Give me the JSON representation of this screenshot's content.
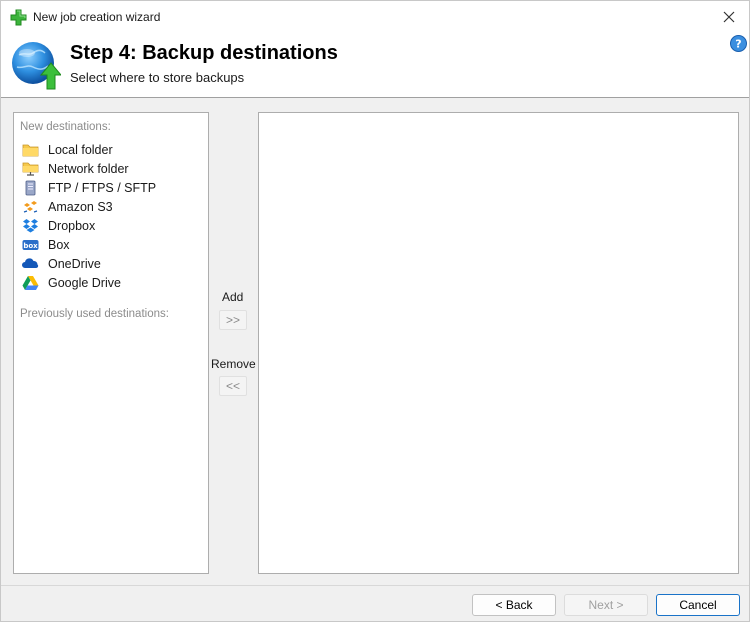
{
  "window": {
    "title": "New job creation wizard"
  },
  "header": {
    "step_title": "Step 4: Backup destinations",
    "step_subtitle": "Select where to store backups"
  },
  "left_panel": {
    "new_label": "New destinations:",
    "items": [
      {
        "label": "Local folder",
        "icon": "folder-icon"
      },
      {
        "label": "Network folder",
        "icon": "network-folder-icon"
      },
      {
        "label": "FTP / FTPS / SFTP",
        "icon": "ftp-server-icon"
      },
      {
        "label": "Amazon S3",
        "icon": "amazon-s3-icon"
      },
      {
        "label": "Dropbox",
        "icon": "dropbox-icon"
      },
      {
        "label": "Box",
        "icon": "box-icon"
      },
      {
        "label": "OneDrive",
        "icon": "onedrive-icon"
      },
      {
        "label": "Google Drive",
        "icon": "google-drive-icon"
      }
    ],
    "previous_label": "Previously used destinations:"
  },
  "middle": {
    "add_label": "Add",
    "add_button": ">>",
    "remove_label": "Remove",
    "remove_button": "<<"
  },
  "footer": {
    "back_label": "< Back",
    "next_label": "Next >",
    "cancel_label": "Cancel"
  },
  "colors": {
    "accent": "#1a73c8",
    "disabled_text": "#a0a0a0",
    "label_gray": "#8c8c8c"
  }
}
